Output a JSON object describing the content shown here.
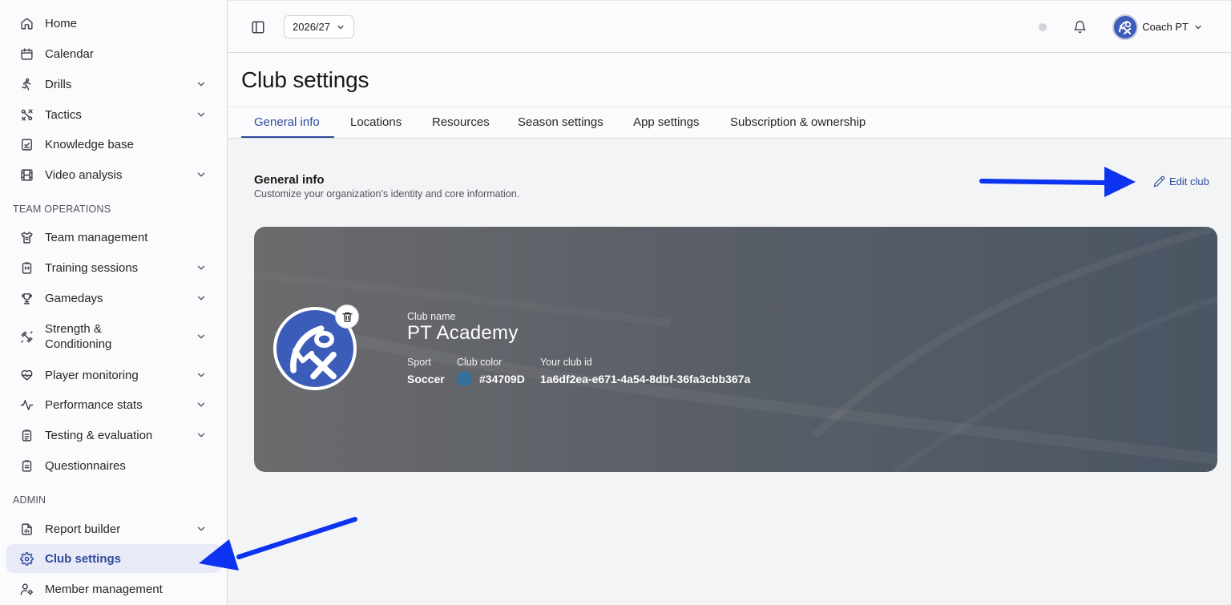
{
  "sidebar": {
    "items": [
      {
        "label": "Home",
        "icon": "home-icon"
      },
      {
        "label": "Calendar",
        "icon": "calendar-icon"
      },
      {
        "label": "Drills",
        "icon": "running-icon"
      },
      {
        "label": "Tactics",
        "icon": "tactics-icon"
      },
      {
        "label": "Knowledge base",
        "icon": "checkbook-icon"
      },
      {
        "label": "Video analysis",
        "icon": "film-icon"
      },
      {
        "label": "Team management",
        "icon": "shirt-icon"
      },
      {
        "label": "Training sessions",
        "icon": "clipboard-icon"
      },
      {
        "label": "Gamedays",
        "icon": "trophy-icon"
      },
      {
        "label": "Strength &",
        "label2": "Conditioning",
        "icon": "dumbbell-icon"
      },
      {
        "label": "Player monitoring",
        "icon": "heart-pulse-icon"
      },
      {
        "label": "Performance stats",
        "icon": "activity-icon"
      },
      {
        "label": "Testing & evaluation",
        "icon": "clipboard-list-icon"
      },
      {
        "label": "Questionnaires",
        "icon": "clipboard-check-icon"
      },
      {
        "label": "Report builder",
        "icon": "report-icon"
      },
      {
        "label": "Club settings",
        "icon": "gear-icon"
      },
      {
        "label": "Member management",
        "icon": "user-gear-icon"
      }
    ],
    "sections": {
      "team_operations": "TEAM OPERATIONS",
      "admin": "ADMIN"
    }
  },
  "topbar": {
    "season": "2026/27",
    "user_name": "Coach PT"
  },
  "page": {
    "title": "Club settings",
    "tabs": [
      {
        "label": "General info"
      },
      {
        "label": "Locations"
      },
      {
        "label": "Resources"
      },
      {
        "label": "Season settings"
      },
      {
        "label": "App settings"
      },
      {
        "label": "Subscription & ownership"
      }
    ]
  },
  "general_info": {
    "title": "General info",
    "subtitle": "Customize your organization’s identity and core information.",
    "edit_label": "Edit club"
  },
  "club": {
    "name_label": "Club name",
    "name": "PT Academy",
    "sport_label": "Sport",
    "sport": "Soccer",
    "color_label": "Club color",
    "color": "#34709D",
    "id_label": "Your club id",
    "id": "1a6df2ea-e671-4a54-8dbf-36fa3cbb367a"
  },
  "colors": {
    "accent": "#2f4a9b",
    "annotation_arrow": "#0b33f0",
    "logo_blue": "#3b5cb8"
  }
}
